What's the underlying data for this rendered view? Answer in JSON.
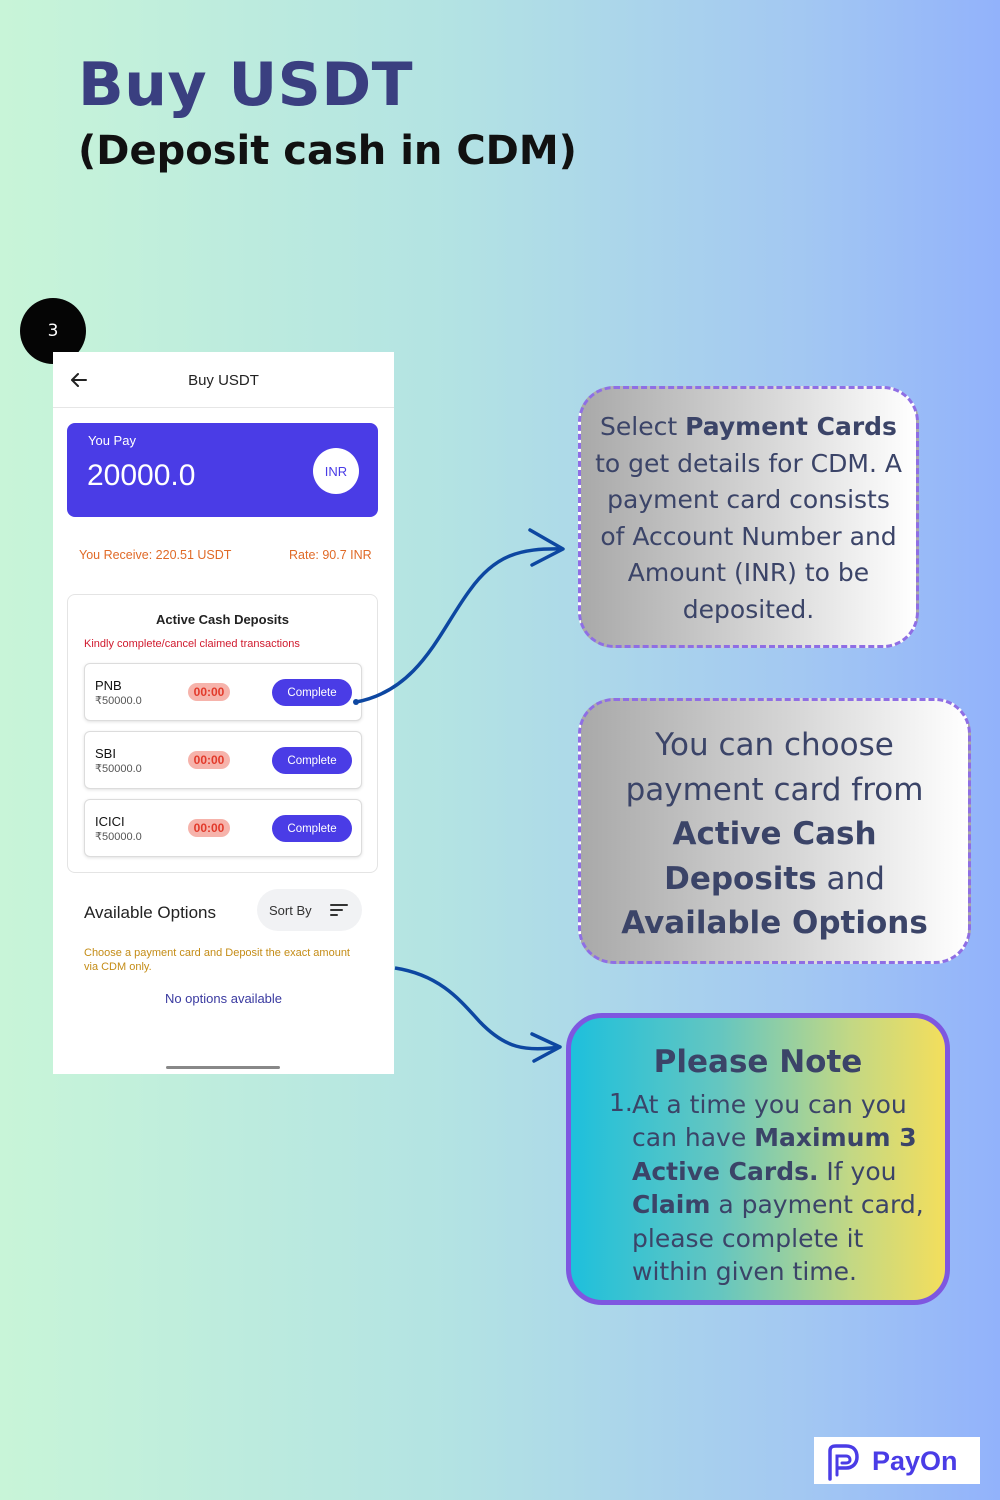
{
  "page": {
    "title": "Buy USDT",
    "subtitle": "(Deposit cash in CDM)",
    "step_number": "3"
  },
  "phone": {
    "header_title": "Buy USDT",
    "you_pay_label": "You Pay",
    "you_pay_amount": "20000.0",
    "currency": "INR",
    "you_receive": "You Receive: 220.51 USDT",
    "rate": "Rate: 90.7 INR",
    "active_deposits": {
      "title": "Active Cash Deposits",
      "warning": "Kindly complete/cancel claimed transactions",
      "items": [
        {
          "bank": "PNB",
          "amount": "₹50000.0",
          "timer": "00:00",
          "button": "Complete"
        },
        {
          "bank": "SBI",
          "amount": "₹50000.0",
          "timer": "00:00",
          "button": "Complete"
        },
        {
          "bank": "ICICI",
          "amount": "₹50000.0",
          "timer": "00:00",
          "button": "Complete"
        }
      ]
    },
    "available_options": {
      "title": "Available Options",
      "sort_label": "Sort By",
      "note": "Choose a payment card and Deposit the exact amount via CDM only.",
      "empty_text": "No options available"
    }
  },
  "callouts": {
    "c1": {
      "t1": "Select ",
      "b1": "Payment Cards",
      "t2": " to get details for CDM. A payment card consists of Account Number and Amount (INR) to be deposited."
    },
    "c2": {
      "t1": "You can choose payment card from ",
      "b1": "Active Cash Deposits",
      "t2": " and ",
      "b2": "Available Options"
    },
    "note": {
      "title": "Please Note",
      "number": "1.",
      "t1": "At a time you can you can have ",
      "b1": "Maximum 3 Active Cards.",
      "t2": " If you ",
      "b2": "Claim",
      "t3": " a payment card, please complete it within given time."
    }
  },
  "logo": {
    "text": "PayOn"
  },
  "colors": {
    "brand": "#4a3ce6",
    "title": "#3a3f80",
    "timer_bg": "#f6b3ab",
    "warning": "#d01a2e",
    "receive": "#e06a27",
    "arrow": "#0d47a1"
  }
}
